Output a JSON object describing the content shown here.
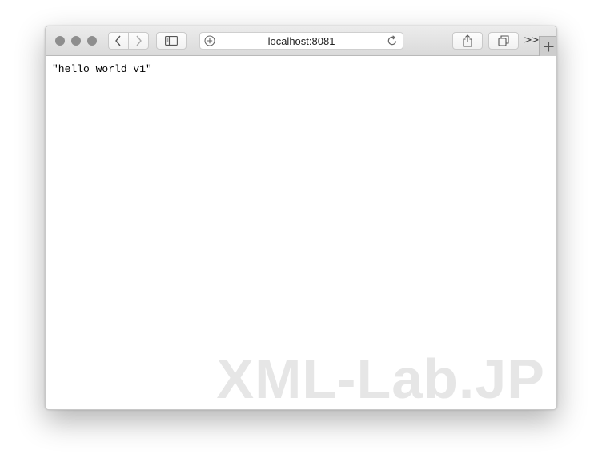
{
  "window": {
    "address": {
      "url": "localhost:8081"
    },
    "content": {
      "body_text": "\"hello world v1\""
    },
    "watermark": "XML-Lab.JP"
  },
  "toolbar": {
    "more_label": ">>",
    "icons": {
      "back": "chevron-left-icon",
      "forward": "chevron-right-icon",
      "sidebar": "sidebar-icon",
      "add_bookmark": "plus-circle-icon",
      "reload": "reload-icon",
      "share": "share-icon",
      "tabs": "tab-overview-icon",
      "new_tab": "plus-icon"
    }
  },
  "colors": {
    "toolbar_top": "#ececec",
    "toolbar_bottom": "#dadada",
    "traffic_light": "#8e8e8e",
    "watermark": "#e6e6e6"
  }
}
